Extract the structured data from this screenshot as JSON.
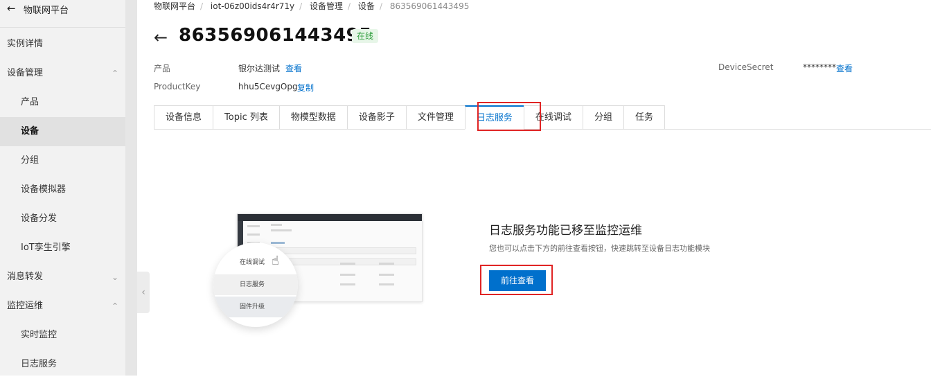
{
  "sidebar": {
    "back_icon": "arrow-left-icon",
    "title": "物联网平台",
    "items": [
      {
        "label": "实例详情"
      },
      {
        "label": "设备管理",
        "chevron": "chevron-up-icon"
      },
      {
        "label": "产品"
      },
      {
        "label": "设备"
      },
      {
        "label": "分组"
      },
      {
        "label": "设备模拟器"
      },
      {
        "label": "设备分发"
      },
      {
        "label": "IoT孪生引擎"
      },
      {
        "label": "消息转发",
        "chevron": "chevron-down-icon"
      },
      {
        "label": "监控运维",
        "chevron": "chevron-up-icon"
      },
      {
        "label": "实时监控"
      },
      {
        "label": "日志服务"
      }
    ]
  },
  "breadcrumb": [
    "物联网平台",
    "iot-06z00ids4r4r71y",
    "设备管理",
    "设备",
    "863569061443495"
  ],
  "header": {
    "title": "863569061443495",
    "status": "在线",
    "status_color": "#2e9d3c"
  },
  "meta": {
    "product_label": "产品",
    "product_value": "银尔达测试",
    "product_link": "查看",
    "productkey_label": "ProductKey",
    "productkey_value": "hhu5CevgOpg",
    "productkey_link": "复制",
    "secret_label": "DeviceSecret",
    "secret_value": "********",
    "secret_link": "查看"
  },
  "tabs": [
    "设备信息",
    "Topic 列表",
    "物模型数据",
    "设备影子",
    "文件管理",
    "日志服务",
    "在线调试",
    "分组",
    "任务"
  ],
  "active_tab_index": 5,
  "illustration": {
    "menu_items": [
      "在线调试",
      "日志服务",
      "固件升级"
    ],
    "cursor_icon": "hand-pointer-icon"
  },
  "notice": {
    "title": "日志服务功能已移至监控运维",
    "description": "您也可以点击下方的前往查看按钮，快速跳转至设备日志功能模块",
    "button": "前往查看"
  },
  "colors": {
    "accent": "#0070cc",
    "highlight": "#e02424"
  }
}
